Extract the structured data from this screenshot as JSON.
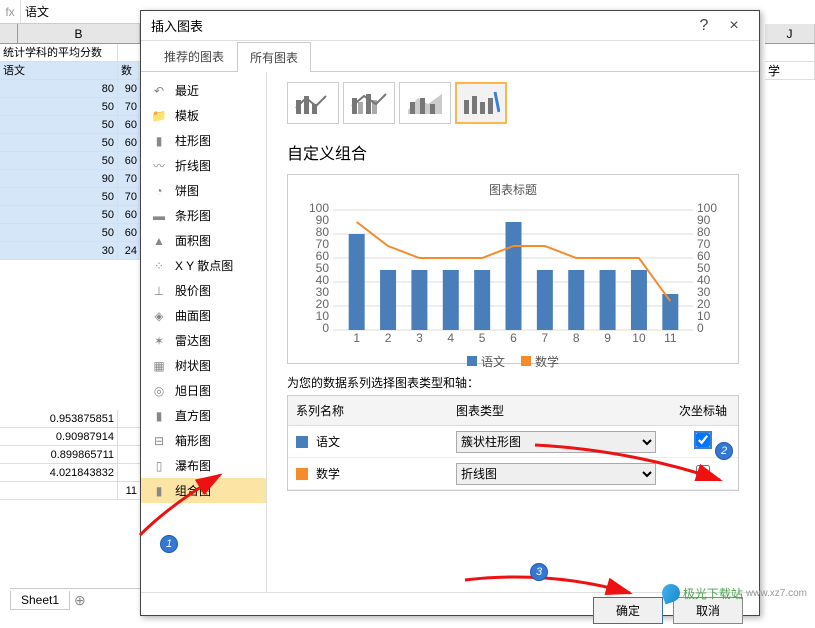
{
  "formula_bar": {
    "fx": "fx",
    "value": "语文"
  },
  "sheet": {
    "col_headers": [
      "",
      "B"
    ],
    "right_col_header": "J",
    "rows_top": [
      {
        "cells": [
          "统计学科的平均分数",
          ""
        ],
        "left": true
      },
      {
        "cells": [
          "语文",
          "数"
        ],
        "left": true,
        "sel": true
      },
      {
        "cells": [
          "80",
          "90"
        ],
        "sel": true
      },
      {
        "cells": [
          "50",
          "70"
        ],
        "sel": true
      },
      {
        "cells": [
          "50",
          "60"
        ],
        "sel": true
      },
      {
        "cells": [
          "50",
          "60"
        ],
        "sel": true
      },
      {
        "cells": [
          "50",
          "60"
        ],
        "sel": true
      },
      {
        "cells": [
          "90",
          "70"
        ],
        "sel": true
      },
      {
        "cells": [
          "50",
          "70"
        ],
        "sel": true
      },
      {
        "cells": [
          "50",
          "60"
        ],
        "sel": true
      },
      {
        "cells": [
          "50",
          "60"
        ],
        "sel": true
      },
      {
        "cells": [
          "30",
          "24"
        ],
        "sel": true
      }
    ],
    "rows_bottom": [
      {
        "cells": [
          "0.953875851",
          ""
        ]
      },
      {
        "cells": [
          "0.90987914",
          ""
        ]
      },
      {
        "cells": [
          "0.899865711",
          ""
        ]
      },
      {
        "cells": [
          "4.021843832",
          ""
        ]
      },
      {
        "cells": [
          "",
          "11"
        ]
      }
    ],
    "tab_name": "Sheet1",
    "right_top_cell": "学"
  },
  "dialog": {
    "title": "插入图表",
    "close": "×",
    "help": "?",
    "tabs": {
      "recommend": "推荐的图表",
      "all": "所有图表"
    },
    "categories": [
      {
        "id": "recent",
        "label": "最近"
      },
      {
        "id": "template",
        "label": "模板"
      },
      {
        "id": "column",
        "label": "柱形图"
      },
      {
        "id": "line",
        "label": "折线图"
      },
      {
        "id": "pie",
        "label": "饼图"
      },
      {
        "id": "bar",
        "label": "条形图"
      },
      {
        "id": "area",
        "label": "面积图"
      },
      {
        "id": "scatter",
        "label": "X Y 散点图"
      },
      {
        "id": "stock",
        "label": "股价图"
      },
      {
        "id": "surface",
        "label": "曲面图"
      },
      {
        "id": "radar",
        "label": "雷达图"
      },
      {
        "id": "treemap",
        "label": "树状图"
      },
      {
        "id": "sunburst",
        "label": "旭日图"
      },
      {
        "id": "histogram",
        "label": "直方图"
      },
      {
        "id": "boxplot",
        "label": "箱形图"
      },
      {
        "id": "waterfall",
        "label": "瀑布图"
      },
      {
        "id": "combo",
        "label": "组合图"
      }
    ],
    "selected_category": "combo",
    "custom_title": "自定义组合",
    "preview": {
      "title": "图表标题",
      "legend": {
        "s1": "语文",
        "s2": "数学"
      }
    },
    "series_section_label": "为您的数据系列选择图表类型和轴：",
    "series_head": {
      "name": "系列名称",
      "type": "图表类型",
      "axis": "次坐标轴"
    },
    "series": [
      {
        "name": "语文",
        "type": "簇状柱形图",
        "secondary": true
      },
      {
        "name": "数学",
        "type": "折线图",
        "secondary": false
      }
    ],
    "buttons": {
      "ok": "确定",
      "cancel": "取消"
    }
  },
  "badges": {
    "b1": "1",
    "b2": "2",
    "b3": "3"
  },
  "watermark": {
    "text": "极光下载站",
    "url": "www.xz7.com"
  },
  "chart_data": {
    "type": "combo",
    "title": "图表标题",
    "categories": [
      1,
      2,
      3,
      4,
      5,
      6,
      7,
      8,
      9,
      10,
      11
    ],
    "series": [
      {
        "name": "语文",
        "type": "bar",
        "axis": "primary",
        "values": [
          80,
          50,
          50,
          50,
          50,
          90,
          50,
          50,
          50,
          50,
          30
        ]
      },
      {
        "name": "数学",
        "type": "line",
        "axis": "secondary",
        "values": [
          90,
          70,
          60,
          60,
          60,
          70,
          70,
          60,
          60,
          60,
          24
        ]
      }
    ],
    "ylim_primary": [
      0,
      100
    ],
    "ylim_secondary": [
      0,
      100
    ],
    "y_ticks": [
      0,
      10,
      20,
      30,
      40,
      50,
      60,
      70,
      80,
      90,
      100
    ]
  }
}
